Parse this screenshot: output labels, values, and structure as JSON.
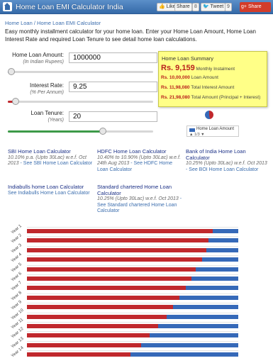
{
  "header": {
    "title": "Home Loan EMI Calculator India",
    "like": "Like",
    "share1": "Share",
    "count1": "8",
    "tweet": "Tweet",
    "count2": "9",
    "gplus": "Share"
  },
  "breadcrumb": "Home Loan / Home Loan EMI Calculator",
  "intro": "Easy monthly installment calculator for your home loan. Enter your Home Loan Amount, Home Loan Interest Rate and required Loan Tenure to see detail home loan calculations.",
  "form": {
    "amount": {
      "label": "Home Loan Amount:",
      "hint": "(In Indian Rupees)",
      "value": "1000000",
      "slider": 0.05
    },
    "rate": {
      "label": "Interest Rate:",
      "hint": "(% Per Annum)",
      "value": "9.25",
      "slider": 0.06
    },
    "tenure": {
      "label": "Loan Tenure:",
      "hint": "(Years)",
      "value": "20",
      "slider": 0.65
    }
  },
  "summary": {
    "title": "Home Loan Summary",
    "emi": "Rs. 9,159",
    "emi_label": "Monthly Instalment",
    "loan": "Rs. 10,00,000",
    "loan_label": "Loan Amount",
    "interest": "Rs. 11,98,080",
    "interest_label": "Total Interest Amount",
    "total": "Rs. 21,98,080",
    "total_label": "Total Amount (Principal + Interest)"
  },
  "legend": {
    "label": "Home Loan Amount",
    "page": "1/3"
  },
  "cards": [
    {
      "title": "SBI Home Loan Calculator",
      "desc": "10.10% p.a. (Upto 30Lac) w.e.f. Oct 2013",
      "link": " - See SBI Home Loan Calculator"
    },
    {
      "title": "HDFC Home Loan Calculator",
      "desc": "10.40% to 10.90% (Upto 30Lac) w.e.f. 24th Aug 2013",
      "link": " - See HDFC Home Loan Calculator"
    },
    {
      "title": "Bank of India Home Loan Calculator",
      "desc": "10.25% (Upto 30Lac) w.e.f. Oct 2013",
      "link": " - See BOI Home Loan Calculator"
    },
    {
      "title": "Indiabulls home Loan Calculator",
      "desc": "",
      "link": "See Indiabulls Home Loan Calculator"
    },
    {
      "title": "Standard chartered Home Loan Calculator",
      "desc": "10.25% (Upto 30Lac) w.e.f. Oct 2013",
      "link": " - See Standard chartered Home Loan Calculator"
    }
  ],
  "chart_data": {
    "type": "bar",
    "orientation": "horizontal",
    "stacked": true,
    "categories": [
      "Year 1",
      "Year 2",
      "Year 3",
      "Year 4",
      "Year 5",
      "Year 6",
      "Year 7",
      "Year 8",
      "Year 9",
      "Year 10",
      "Year 11",
      "Year 12",
      "Year 13",
      "Year 14"
    ],
    "series": [
      {
        "name": "",
        "color": "#c0282d",
        "values": [
          0.88,
          0.86,
          0.85,
          0.83,
          0.8,
          0.78,
          0.75,
          0.72,
          0.69,
          0.66,
          0.62,
          0.58,
          0.54,
          0.49
        ]
      },
      {
        "name": "",
        "color": "#3669b8",
        "values": [
          0.12,
          0.14,
          0.15,
          0.17,
          0.2,
          0.22,
          0.25,
          0.28,
          0.31,
          0.34,
          0.38,
          0.42,
          0.46,
          0.51
        ]
      }
    ]
  }
}
